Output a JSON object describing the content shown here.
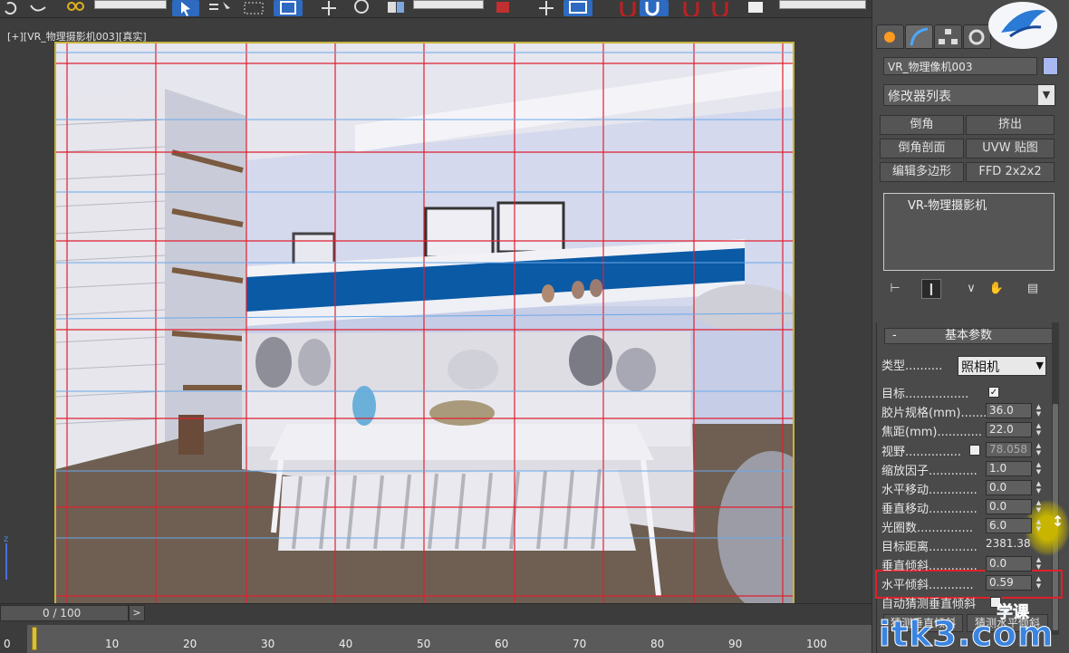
{
  "colors": {
    "ui_bg": "#4a4a4a",
    "viewport_frame": "#c8b23c",
    "safe_frame_red": "#e02030",
    "safe_frame_blue": "#6aa8e8",
    "accent_blue": "#0b5aa0",
    "highlight_red": "#e0202a"
  },
  "viewport": {
    "label": "[+][VR_物理摄影机003][真实]",
    "axis_label": "z"
  },
  "command_panel": {
    "tabs": [
      "create-icon",
      "modify-icon",
      "hierarchy-icon",
      "motion-icon",
      "display-icon"
    ],
    "object_name": "VR_物理像机003",
    "modifier_list": "修改器列表",
    "modifier_buttons": [
      "倒角",
      "挤出",
      "倒角剖面",
      "UVW 贴图",
      "编辑多边形",
      "FFD 2x2x2"
    ],
    "stack_item": "VR-物理摄影机",
    "stack_tools": [
      "pin-stack-icon",
      "show-end-result-icon",
      "make-unique-icon",
      "remove-modifier-icon",
      "configure-sets-icon"
    ]
  },
  "parameters": {
    "rollout_title": "基本参数",
    "collapse_symbol": "-",
    "type_label": "类型..........",
    "type_value": "照相机",
    "rows": [
      {
        "label": "目标.................",
        "kind": "check",
        "checked": true
      },
      {
        "label": "胶片规格(mm)........",
        "kind": "spin",
        "value": "36.0"
      },
      {
        "label": "焦距(mm)............",
        "kind": "spin",
        "value": "22.0"
      },
      {
        "label": "视野...............",
        "kind": "checkspin",
        "checked": false,
        "value": "78.058"
      },
      {
        "label": "缩放因子.............",
        "kind": "spin",
        "value": "1.0"
      },
      {
        "label": "水平移动.............",
        "kind": "spin",
        "value": "0.0"
      },
      {
        "label": "垂直移动.............",
        "kind": "spin",
        "value": "0.0"
      },
      {
        "label": "光圈数...............",
        "kind": "spin",
        "value": "6.0"
      },
      {
        "label": "目标距离.............",
        "kind": "plain",
        "value": "2381.38"
      },
      {
        "label": "垂直倾斜.............",
        "kind": "spin",
        "value": "0.0"
      },
      {
        "label": "水平倾斜............",
        "kind": "spin",
        "value": "0.59"
      },
      {
        "label": "自动猜测垂直倾斜",
        "kind": "check",
        "checked": false
      }
    ],
    "guess_vertical_button": "猜测垂直倾斜",
    "guess_horizontal_button": "猜测水平倾斜"
  },
  "timeline": {
    "slider_text": "0 / 100",
    "next_symbol": ">",
    "start_frame": "0",
    "ticks": [
      "10",
      "20",
      "30",
      "40",
      "50",
      "60",
      "70",
      "80",
      "90",
      "100"
    ]
  },
  "watermark": {
    "text": "itk3.com",
    "sub": "学课"
  }
}
